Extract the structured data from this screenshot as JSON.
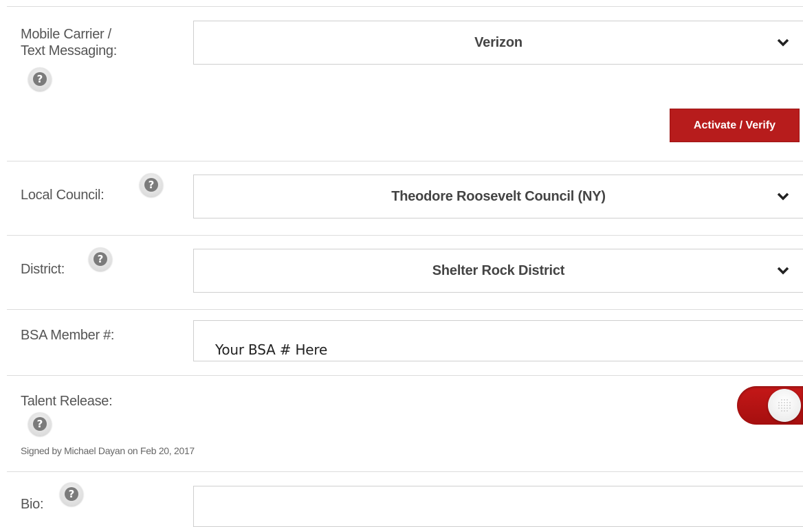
{
  "mobile_carrier": {
    "label_line1": "Mobile Carrier /",
    "label_line2": "Text Messaging:",
    "selected": "Verizon",
    "activate_button": "Activate / Verify"
  },
  "local_council": {
    "label": "Local Council:",
    "selected": "Theodore Roosevelt Council (NY)"
  },
  "district": {
    "label": "District:",
    "selected": "Shelter Rock District"
  },
  "bsa_member": {
    "label": "BSA Member #:",
    "value": "Your BSA # Here"
  },
  "talent_release": {
    "label": "Talent Release:",
    "toggle_on": true,
    "signed_text": "Signed by Michael Dayan on Feb 20, 2017"
  },
  "bio": {
    "label": "Bio:",
    "value": ""
  },
  "icons": {
    "help": "?",
    "dropdown": "chevron-down-icon"
  },
  "colors": {
    "accent": "#b71c1c",
    "border": "#cfcfcf",
    "divider": "#dcdcdc",
    "label": "#555555"
  }
}
